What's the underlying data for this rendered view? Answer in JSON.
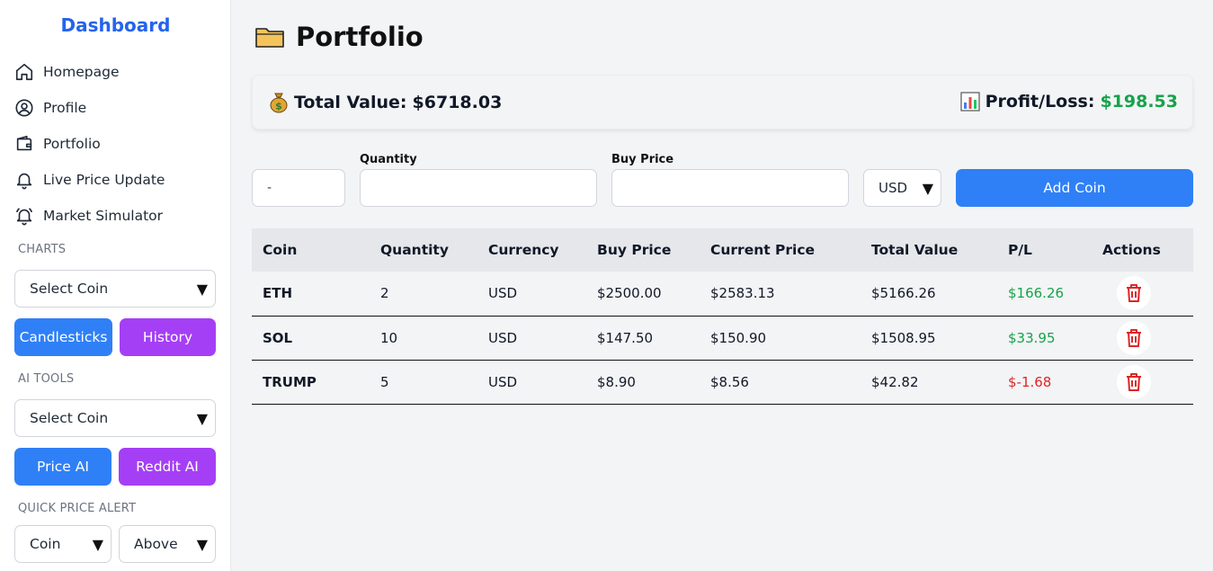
{
  "sidebar": {
    "brand": "Dashboard",
    "nav": [
      {
        "label": "Homepage",
        "icon": "home-icon"
      },
      {
        "label": "Profile",
        "icon": "user-circle-icon"
      },
      {
        "label": "Portfolio",
        "icon": "wallet-icon"
      },
      {
        "label": "Live Price Update",
        "icon": "bell-icon"
      },
      {
        "label": "Market Simulator",
        "icon": "bell-ring-icon"
      }
    ],
    "charts": {
      "label": "CHARTS",
      "select": "Select Coin",
      "candlesticks": "Candlesticks",
      "history": "History"
    },
    "ai_tools": {
      "label": "AI TOOLS",
      "select": "Select Coin",
      "price_ai": "Price AI",
      "reddit_ai": "Reddit AI"
    },
    "alert": {
      "label": "QUICK PRICE ALERT",
      "coin": "Coin",
      "condition": "Above"
    }
  },
  "main": {
    "title": "Portfolio",
    "title_icon": "folder-icon",
    "summary": {
      "total_label": "Total Value:",
      "total_value": "$6718.03",
      "pl_label": "Profit/Loss:",
      "pl_value": "$198.53"
    },
    "form": {
      "coin_value": "-",
      "quantity_label": "Quantity",
      "quantity_value": "",
      "buy_price_label": "Buy Price",
      "buy_price_value": "",
      "currency": "USD",
      "add_button": "Add Coin"
    },
    "table": {
      "headers": [
        "Coin",
        "Quantity",
        "Currency",
        "Buy Price",
        "Current Price",
        "Total Value",
        "P/L",
        "Actions"
      ],
      "rows": [
        {
          "coin": "ETH",
          "quantity": "2",
          "currency": "USD",
          "buy": "$2500.00",
          "current": "$2583.13",
          "total": "$5166.26",
          "pl": "$166.26",
          "pl_positive": true
        },
        {
          "coin": "SOL",
          "quantity": "10",
          "currency": "USD",
          "buy": "$147.50",
          "current": "$150.90",
          "total": "$1508.95",
          "pl": "$33.95",
          "pl_positive": true
        },
        {
          "coin": "TRUMP",
          "quantity": "5",
          "currency": "USD",
          "buy": "$8.90",
          "current": "$8.56",
          "total": "$42.82",
          "pl": "$-1.68",
          "pl_positive": false
        }
      ]
    }
  },
  "colors": {
    "brand": "#2563eb",
    "blue_button": "#2f80f7",
    "purple_button": "#a53ff5",
    "positive": "#16a34a",
    "negative": "#dc2626"
  }
}
